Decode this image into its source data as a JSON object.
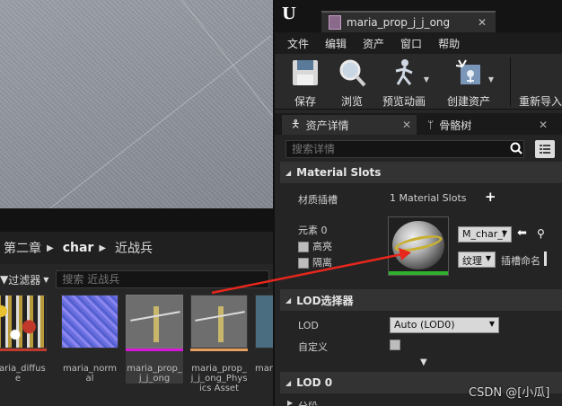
{
  "editor": {
    "tab_title": "maria_prop_j_j_ong",
    "menu": [
      "文件",
      "编辑",
      "资产",
      "窗口",
      "帮助"
    ],
    "toolbar": {
      "save": "保存",
      "browse": "浏览",
      "preview_anim": "预览动画",
      "create_asset": "创建资产",
      "reimport": "重新导入"
    },
    "panel_tabs": {
      "details": "资产详情",
      "skeleton": "骨骼树"
    },
    "search_placeholder": "搜索详情",
    "material_slots": {
      "header": "Material Slots",
      "label": "材质插槽",
      "value": "1 Material Slots",
      "element_label": "元素 0",
      "highlight_label": "高亮",
      "isolate_label": "隔离",
      "material_name": "M_char_i",
      "texture_btn": "纹理",
      "slot_name_label": "插槽命名"
    },
    "lod_picker": {
      "header": "LOD选择器",
      "lod_label": "LOD",
      "lod_value": "Auto (LOD0)",
      "custom_label": "自定义"
    },
    "lod0": {
      "header": "LOD 0",
      "section_label": "分段"
    }
  },
  "content_browser": {
    "breadcrumbs": [
      "第二章",
      "char",
      "近战兵"
    ],
    "filter_label": "过滤器",
    "search_placeholder": "搜索 近战兵",
    "assets": [
      {
        "name": "maria_diffuse",
        "bar_color": "#c0392b"
      },
      {
        "name": "maria_normal",
        "bar_color": ""
      },
      {
        "name": "maria_prop_j_j_ong",
        "bar_color": "#d815d8",
        "selected": true
      },
      {
        "name": "maria_prop_j_j_ong_Physics Asset",
        "bar_color": "#e7a060"
      },
      {
        "name": "mar",
        "bar_color": ""
      }
    ]
  },
  "watermark": "CSDN @[小瓜]"
}
